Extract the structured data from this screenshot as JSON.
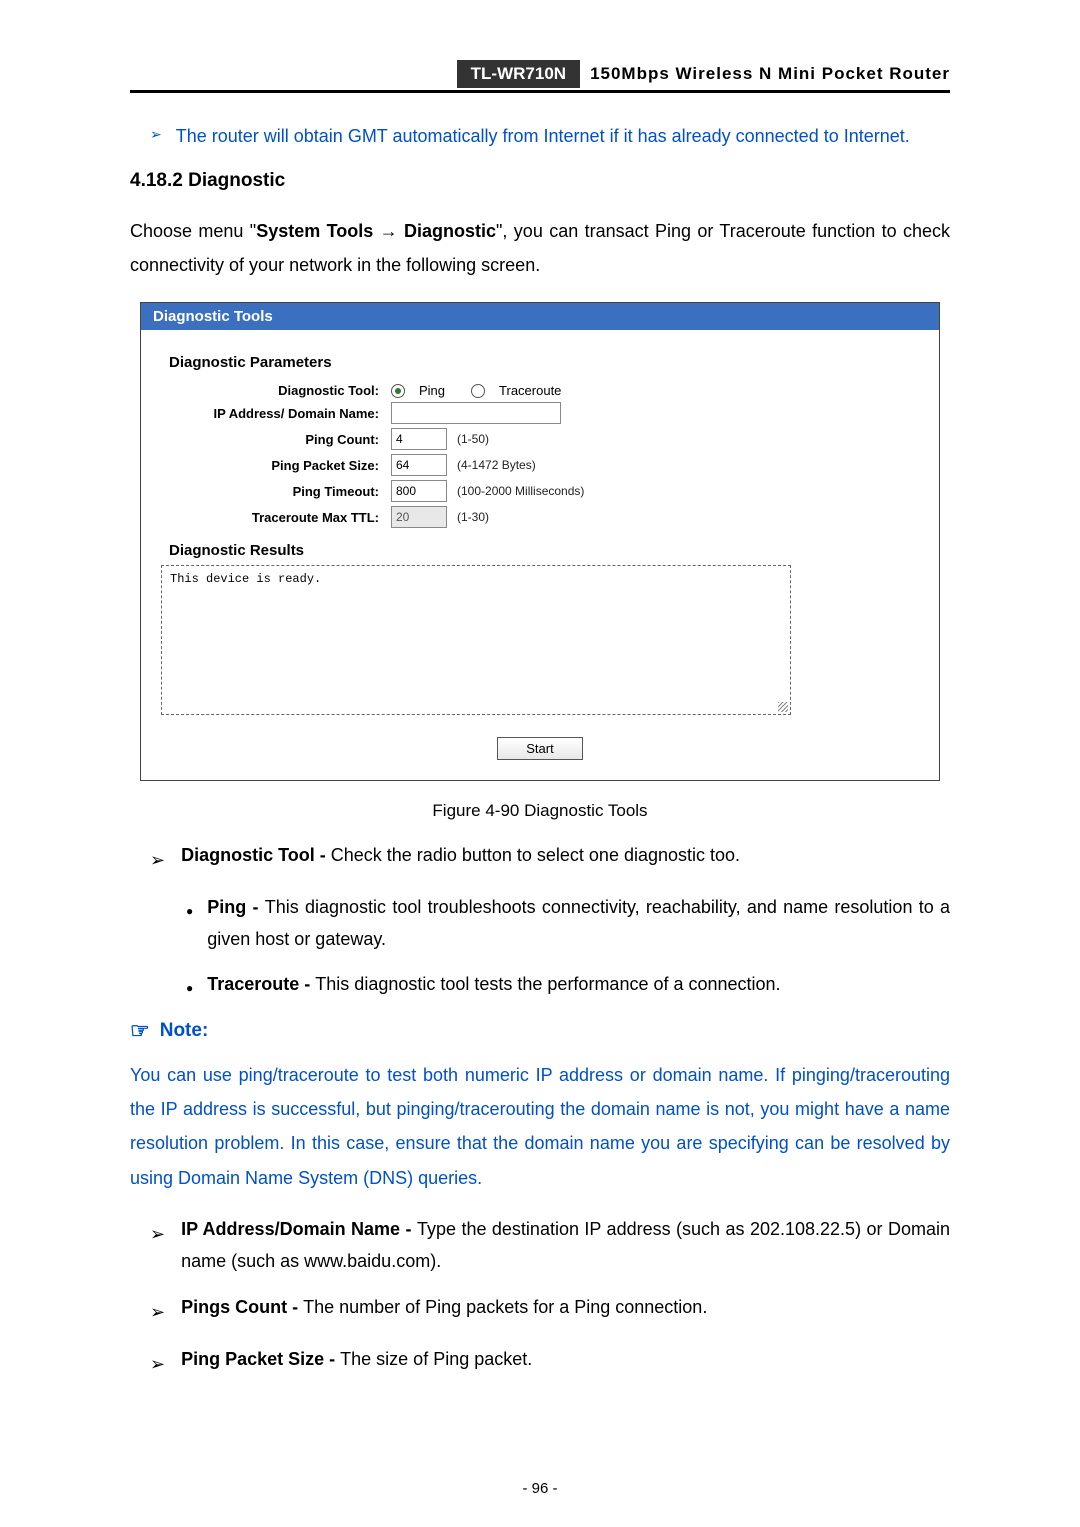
{
  "header": {
    "model": "TL-WR710N",
    "title": "150Mbps Wireless N Mini Pocket Router"
  },
  "top_bullet": "The router will obtain GMT automatically from Internet if it has already connected to Internet.",
  "section_number": "4.18.2",
  "section_title": "Diagnostic",
  "intro_prefix": "Choose menu \"",
  "intro_path_a": "System Tools",
  "intro_arrow": "→",
  "intro_path_b": "Diagnostic",
  "intro_suffix": "\", you can transact Ping or Traceroute function to check connectivity of your network in the following screen.",
  "figure": {
    "panel_title": "Diagnostic Tools",
    "params_title": "Diagnostic Parameters",
    "labels": {
      "tool": "Diagnostic Tool:",
      "ip": "IP Address/ Domain Name:",
      "count": "Ping Count:",
      "size": "Ping Packet Size:",
      "timeout": "Ping Timeout:",
      "ttl": "Traceroute Max TTL:"
    },
    "radio_ping": "Ping",
    "radio_trace": "Traceroute",
    "values": {
      "ip": "",
      "count": "4",
      "size": "64",
      "timeout": "800",
      "ttl": "20"
    },
    "hints": {
      "count": "(1-50)",
      "size": "(4-1472 Bytes)",
      "timeout": "(100-2000 Milliseconds)",
      "ttl": "(1-30)"
    },
    "results_title": "Diagnostic Results",
    "results_text": "This device is ready.",
    "start_label": "Start",
    "caption": "Figure 4-90    Diagnostic Tools"
  },
  "items": {
    "diag_tool_label": "Diagnostic Tool - ",
    "diag_tool_text": "Check the radio button to select one diagnostic too.",
    "ping_label": "Ping - ",
    "ping_text": "This diagnostic tool troubleshoots connectivity, reachability, and name resolution to a given host or gateway.",
    "trace_label": "Traceroute - ",
    "trace_text": "This diagnostic tool tests the performance of a connection.",
    "ip_label": "IP Address/Domain Name - ",
    "ip_text": "Type the destination IP address (such as 202.108.22.5) or Domain name (such as www.baidu.com).",
    "pcount_label": "Pings Count - ",
    "pcount_text": "The number of Ping packets for a Ping connection.",
    "psize_label": "Ping Packet Size - ",
    "psize_text": "The size of Ping packet."
  },
  "note": {
    "label": "Note:",
    "body": "You can use ping/traceroute to test both numeric IP address or domain name. If pinging/tracerouting the IP address is successful, but pinging/tracerouting the domain name is not, you might have a name resolution problem. In this case, ensure that the domain name you are specifying can be resolved by using Domain Name System (DNS) queries."
  },
  "page_number": "- 96 -"
}
